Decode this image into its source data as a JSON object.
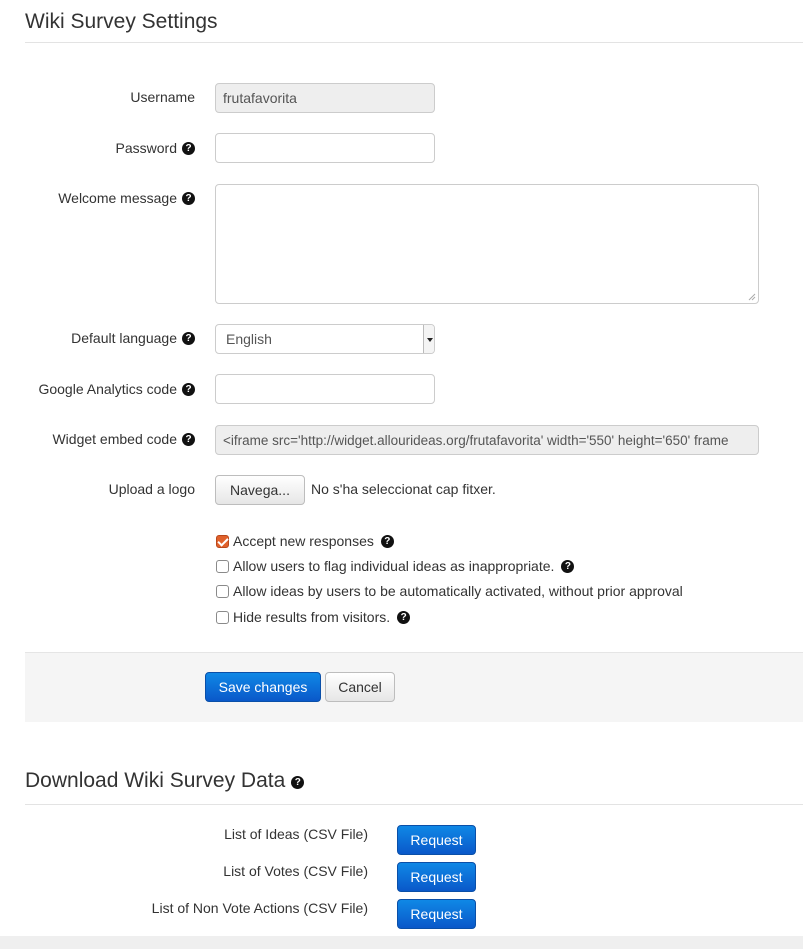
{
  "settings": {
    "title": "Wiki Survey Settings",
    "username_label": "Username",
    "username_value": "frutafavorita",
    "password_label": "Password",
    "password_value": "",
    "welcome_label": "Welcome message",
    "welcome_value": "",
    "language_label": "Default language",
    "language_value": "English",
    "analytics_label": "Google Analytics code",
    "analytics_value": "",
    "embed_label": "Widget embed code",
    "embed_value": "<iframe src='http://widget.allourideas.org/frutafavorita' width='550' height='650' frame",
    "logo_label": "Upload a logo",
    "browse_label": "Navega...",
    "no_file_text": "No s'ha seleccionat cap fitxer.",
    "options": [
      {
        "label": "Accept new responses",
        "checked": true,
        "help": true
      },
      {
        "label": "Allow users to flag individual ideas as inappropriate.",
        "checked": false,
        "help": true
      },
      {
        "label": "Allow ideas by users to be automatically activated, without prior approval",
        "checked": false,
        "help": false
      },
      {
        "label": "Hide results from visitors.",
        "checked": false,
        "help": true
      }
    ],
    "save_label": "Save changes",
    "cancel_label": "Cancel",
    "help_glyph": "?"
  },
  "download": {
    "title": "Download Wiki Survey Data",
    "items": [
      {
        "label": "List of Ideas (CSV File)",
        "button": "Request"
      },
      {
        "label": "List of Votes (CSV File)",
        "button": "Request"
      },
      {
        "label": "List of Non Vote Actions (CSV File)",
        "button": "Request"
      }
    ]
  },
  "colors": {
    "primary": "#0a6ad8",
    "checkbox_checked": "#e0612b"
  }
}
